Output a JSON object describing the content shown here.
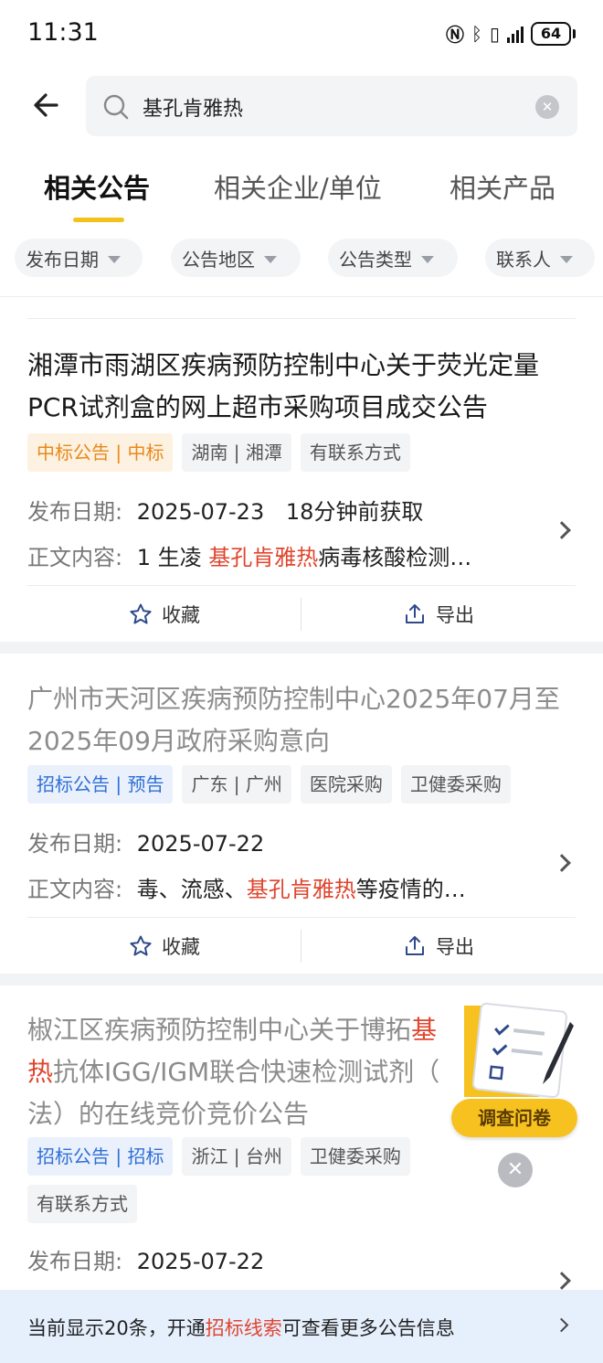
{
  "status_bar": {
    "time": "11:31",
    "battery": "64"
  },
  "search": {
    "query": "基孔肯雅热"
  },
  "tabs": [
    {
      "label": "相关公告",
      "active": true
    },
    {
      "label": "相关企业/单位",
      "active": false
    },
    {
      "label": "相关产品",
      "active": false
    }
  ],
  "filters": [
    "发布日期",
    "公告地区",
    "公告类型",
    "联系人"
  ],
  "cards": [
    {
      "title": "湘潭市雨湖区疾病预防控制中心关于荧光定量PCR试剂盒的网上超市采购项目成交公告",
      "tags": [
        "中标公告 | 中标",
        "湖南 | 湘潭",
        "有联系方式"
      ],
      "date_label": "发布日期:",
      "date": "2025-07-23",
      "fetched": "18分钟前获取",
      "content_label": "正文内容:",
      "content_before": "1 生凌 ",
      "content_highlight": "基孔肯雅热",
      "content_after": "病毒核酸检测…",
      "collect_label": "收藏",
      "export_label": "导出"
    },
    {
      "title": "广州市天河区疾病预防控制中心2025年07月至2025年09月政府采购意向",
      "tags": [
        "招标公告 | 预告",
        "广东 | 广州",
        "医院采购",
        "卫健委采购"
      ],
      "date_label": "发布日期:",
      "date": "2025-07-22",
      "content_label": "正文内容:",
      "content_before": "毒、流感、",
      "content_highlight": "基孔肯雅热",
      "content_after": "等疫情的…",
      "collect_label": "收藏",
      "export_label": "导出"
    },
    {
      "title_line1_before": "椒江区疾病预防控制中心关于博拓",
      "title_line1_highlight": "基",
      "title_line2_highlight": "热",
      "title_line2_after": "抗体IGG/IGM联合快速检测试剂（",
      "title_line3": "法）的在线竞价竞价公告",
      "tags": [
        "招标公告 | 招标",
        "浙江 | 台州",
        "卫健委采购",
        "有联系方式"
      ],
      "date_label": "发布日期:",
      "date": "2025-07-22"
    }
  ],
  "survey": {
    "label": "调查问卷"
  },
  "banner": {
    "before": "当前显示20条，开通",
    "highlight": "招标线索",
    "after": "可查看更多公告信息"
  },
  "colors": {
    "accent": "#f4c21a",
    "highlight": "#e0452e",
    "tag_orange": "#e8891a",
    "tag_blue": "#2f6fd6",
    "banner_bg": "#e6f0fd"
  }
}
